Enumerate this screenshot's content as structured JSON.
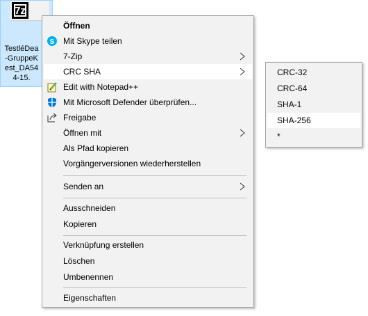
{
  "file": {
    "icon": "7z-archive-icon",
    "logo_text": "7z",
    "label_lines": "TestléDea\n-GruppeK\nest_DA54\n4-15."
  },
  "context_menu": {
    "items": [
      {
        "label": "Öffnen",
        "bold": true
      },
      {
        "label": "Mit Skype teilen",
        "icon": "skype-icon"
      },
      {
        "label": "7-Zip",
        "submenu": true
      },
      {
        "label": "CRC SHA",
        "submenu": true,
        "highlighted": true
      },
      {
        "label": "Edit with Notepad++",
        "icon": "notepad-plus-plus-icon"
      },
      {
        "label": "Mit Microsoft Defender überprüfen...",
        "icon": "defender-shield-icon"
      },
      {
        "label": "Freigabe",
        "icon": "share-icon"
      },
      {
        "label": "Öffnen mit",
        "submenu": true
      },
      {
        "label": "Als Pfad kopieren"
      },
      {
        "label": "Vorgängerversionen wiederherstellen"
      },
      {
        "label": "Senden an",
        "submenu": true
      },
      {
        "label": "Ausschneiden"
      },
      {
        "label": "Kopieren"
      },
      {
        "label": "Verknüpfung erstellen"
      },
      {
        "label": "Löschen"
      },
      {
        "label": "Umbenennen"
      },
      {
        "label": "Eigenschaften"
      }
    ]
  },
  "crc_sha_submenu": {
    "items": [
      {
        "label": "CRC-32"
      },
      {
        "label": "CRC-64"
      },
      {
        "label": "SHA-1"
      },
      {
        "label": "SHA-256",
        "highlighted": true
      },
      {
        "label": "*"
      }
    ]
  },
  "colors": {
    "selection_bg": "#cce8ff",
    "menu_bg": "#f2f2f2",
    "hover_bg": "#ffffff",
    "skype_blue": "#00aff0",
    "defender_blue": "#0078d7"
  }
}
